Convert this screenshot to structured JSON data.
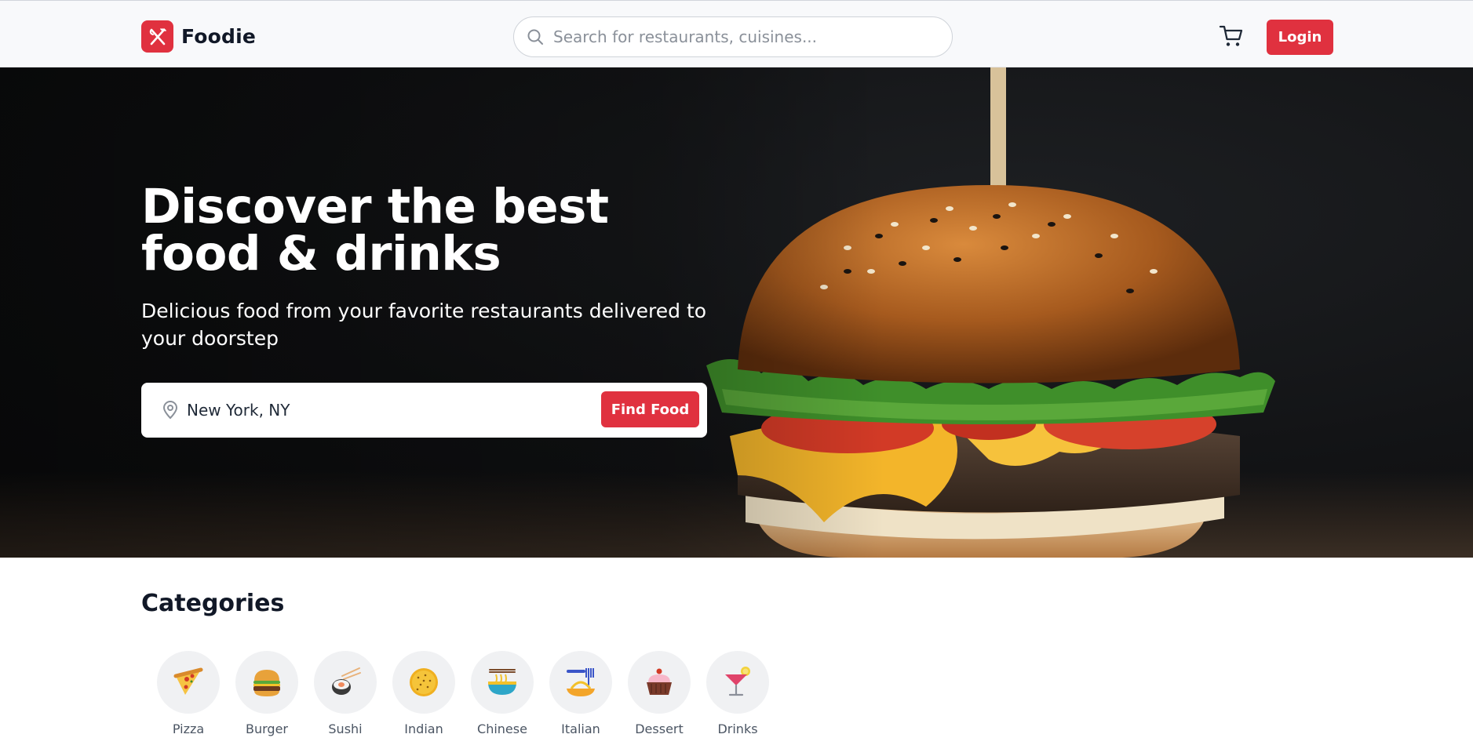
{
  "header": {
    "brand": "Foodie",
    "search_placeholder": "Search for restaurants, cuisines...",
    "login_label": "Login"
  },
  "hero": {
    "title": "Discover the best food & drinks",
    "subtitle": "Delicious food from your favorite restaurants delivered to your doorstep",
    "location_value": "New York, NY",
    "find_button": "Find Food"
  },
  "categories": {
    "title": "Categories",
    "items": [
      {
        "label": "Pizza",
        "icon": "pizza-icon"
      },
      {
        "label": "Burger",
        "icon": "burger-icon"
      },
      {
        "label": "Sushi",
        "icon": "sushi-icon"
      },
      {
        "label": "Indian",
        "icon": "indian-icon"
      },
      {
        "label": "Chinese",
        "icon": "chinese-icon"
      },
      {
        "label": "Italian",
        "icon": "italian-icon"
      },
      {
        "label": "Dessert",
        "icon": "dessert-icon"
      },
      {
        "label": "Drinks",
        "icon": "drinks-icon"
      }
    ]
  },
  "colors": {
    "accent": "#e0313f",
    "header_bg": "#f8f9fb",
    "text_dark": "#111827",
    "text_muted": "#4b5563"
  }
}
